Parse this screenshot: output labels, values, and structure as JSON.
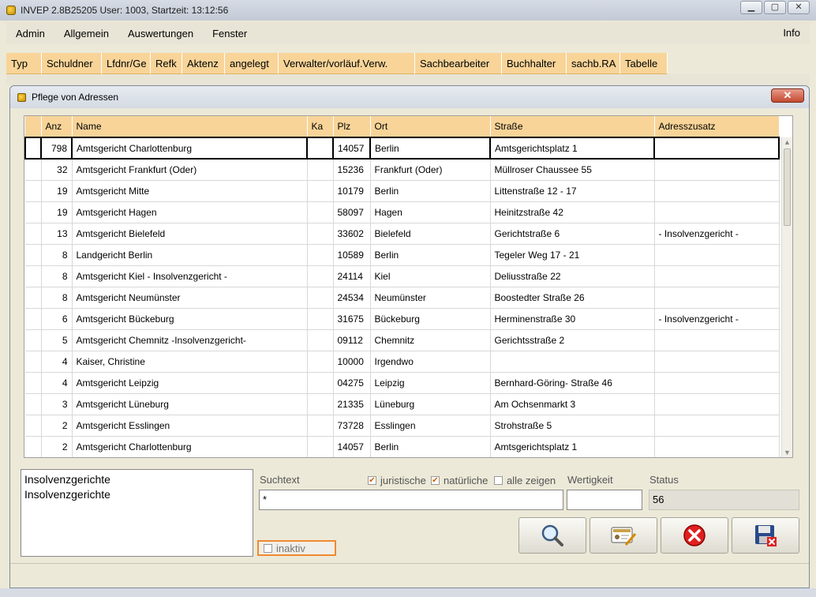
{
  "window": {
    "title": "INVEP 2.8B25205 User: 1003, Startzeit: 13:12:56"
  },
  "menu": {
    "items": [
      "Admin",
      "Allgemein",
      "Auswertungen",
      "Fenster"
    ],
    "info": "Info"
  },
  "toolbar": {
    "tabs": [
      "Typ",
      "Schuldner",
      "Lfdnr/Ge",
      "Refk",
      "Aktenz",
      "angelegt",
      "Verwalter/vorläuf.Verw.",
      "Sachbearbeiter",
      "Buchhalter",
      "sachb.RA",
      "Tabelle"
    ]
  },
  "dialog": {
    "title": "Pflege von Adressen",
    "columns": [
      "",
      "Anz",
      "Name",
      "Ka",
      "Plz",
      "Ort",
      "Straße",
      "Adresszusatz"
    ],
    "rows": [
      [
        "",
        "798",
        "Amtsgericht Charlottenburg",
        "",
        "14057",
        "Berlin",
        "Amtsgerichtsplatz 1",
        ""
      ],
      [
        "",
        "32",
        "Amtsgericht  Frankfurt (Oder)",
        "",
        "15236",
        "Frankfurt (Oder)",
        "Müllroser Chaussee 55",
        ""
      ],
      [
        "",
        "19",
        "Amtsgericht Mitte",
        "",
        "10179",
        "Berlin",
        "Littenstraße 12 - 17",
        ""
      ],
      [
        "",
        "19",
        "Amtsgericht Hagen",
        "",
        "58097",
        "Hagen",
        "Heinitzstraße 42",
        ""
      ],
      [
        "",
        "13",
        "Amtsgericht Bielefeld",
        "",
        "33602",
        "Bielefeld",
        "Gerichtstraße 6",
        "- Insolvenzgericht -"
      ],
      [
        "",
        "8",
        "Landgericht Berlin",
        "",
        "10589",
        "Berlin",
        "Tegeler Weg 17 - 21",
        ""
      ],
      [
        "",
        "8",
        "Amtsgericht Kiel  - Insolvenzgericht -",
        "",
        "24114",
        "Kiel",
        "Deliusstraße 22",
        ""
      ],
      [
        "",
        "8",
        "Amtsgericht Neumünster",
        "",
        "24534",
        "Neumünster",
        "Boostedter Straße 26",
        ""
      ],
      [
        "",
        "6",
        "Amtsgericht Bückeburg",
        "",
        "31675",
        "Bückeburg",
        "Herminenstraße 30",
        "- Insolvenzgericht -"
      ],
      [
        "",
        "5",
        "Amtsgericht Chemnitz  -Insolvenzgericht-",
        "",
        "09112",
        "Chemnitz",
        "Gerichtsstraße 2",
        ""
      ],
      [
        "",
        "4",
        "Kaiser, Christine",
        "",
        "10000",
        "Irgendwo",
        "",
        ""
      ],
      [
        "",
        "4",
        "Amtsgericht Leipzig",
        "",
        "04275",
        "Leipzig",
        "Bernhard-Göring- Straße 46",
        ""
      ],
      [
        "",
        "3",
        "Amtsgericht Lüneburg",
        "",
        "21335",
        "Lüneburg",
        "Am Ochsenmarkt 3",
        ""
      ],
      [
        "",
        "2",
        "Amtsgericht Esslingen",
        "",
        "73728",
        "Esslingen",
        "Strohstraße 5",
        ""
      ],
      [
        "",
        "2",
        "Amtsgericht Charlottenburg",
        "",
        "14057",
        "Berlin",
        "Amtsgerichtsplatz 1",
        ""
      ]
    ],
    "memo_lines": [
      "Insolvenzgerichte",
      "Insolvenzgerichte"
    ],
    "search": {
      "label": "Suchtext",
      "value": "*",
      "juristische_label": "juristische",
      "juristische_checked": true,
      "natuerliche_label": "natürliche",
      "natuerliche_checked": true,
      "alle_label": "alle zeigen",
      "alle_checked": false
    },
    "wertigkeit": {
      "label": "Wertigkeit",
      "value": ""
    },
    "status": {
      "label": "Status",
      "value": "56"
    },
    "inaktiv": {
      "label": "inaktiv",
      "checked": false
    },
    "buttons": {
      "search_icon": "magnifier-icon",
      "edit_icon": "edit-card-icon",
      "cancel_icon": "cancel-icon",
      "save_close_icon": "save-close-icon"
    },
    "colors": {
      "header": "#f8d498",
      "selection_border": "#000000",
      "inaktiv_border": "#f08a30"
    }
  }
}
